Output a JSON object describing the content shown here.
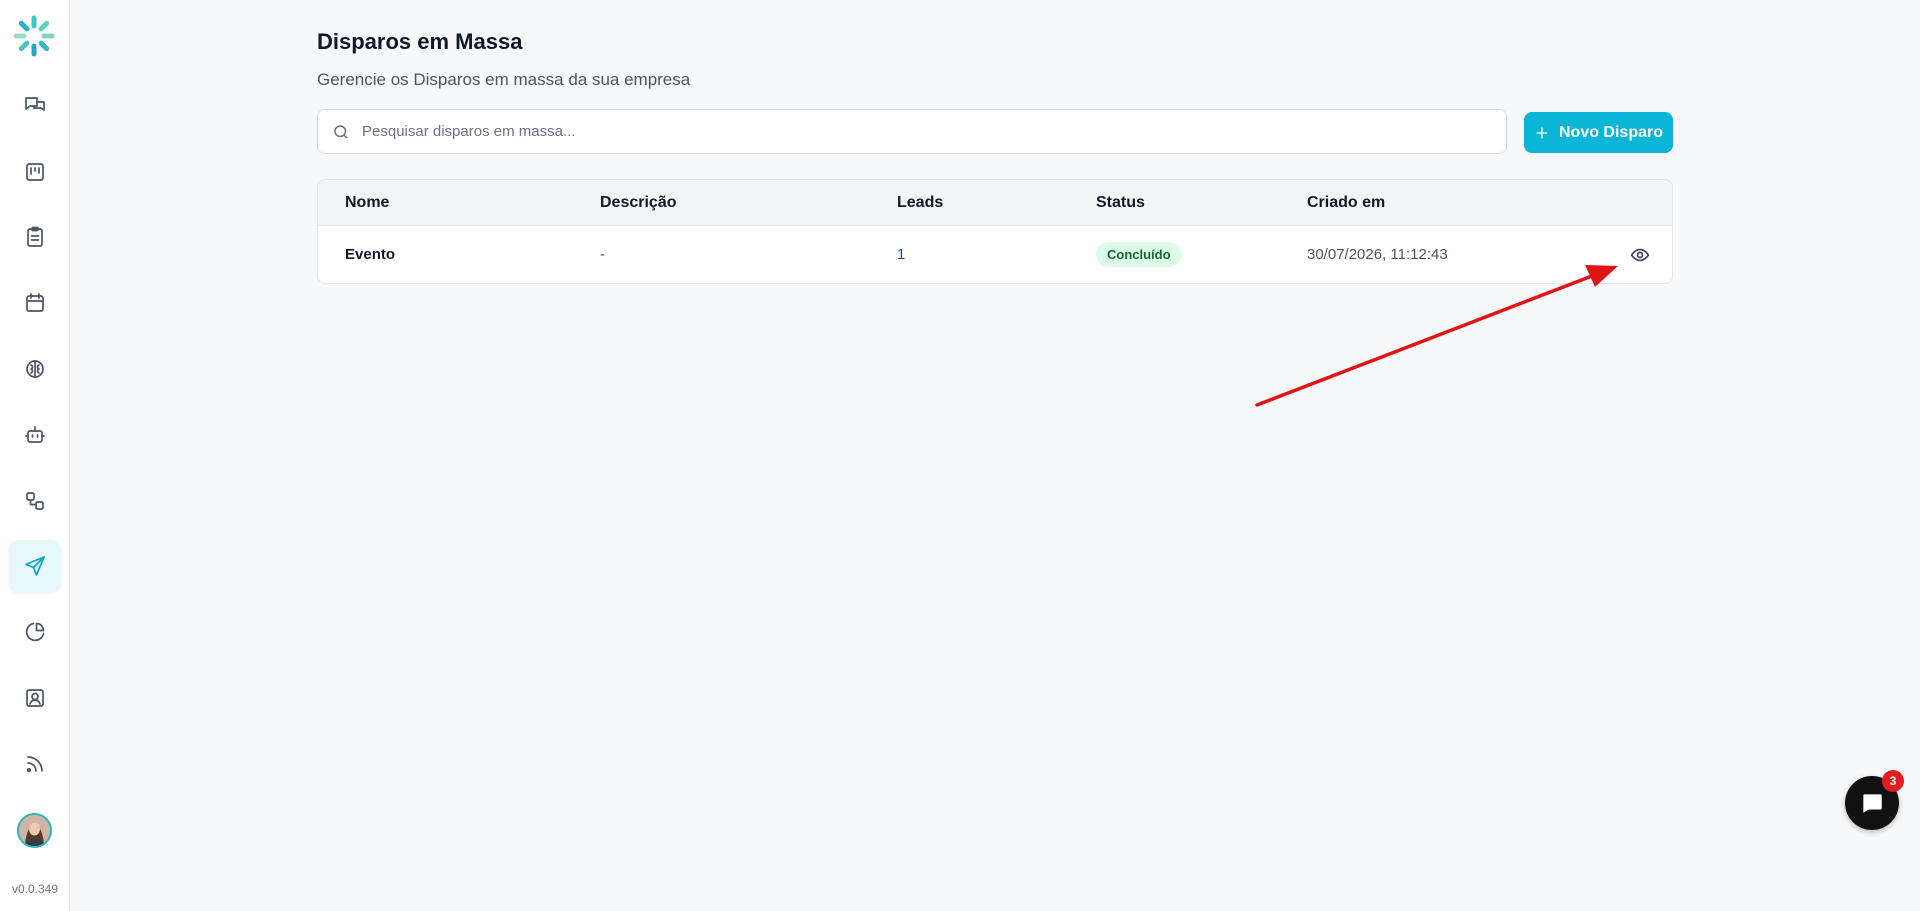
{
  "sidebar": {
    "items": [
      {
        "icon": "chat-icon"
      },
      {
        "icon": "kanban-icon"
      },
      {
        "icon": "clipboard-icon"
      },
      {
        "icon": "calendar-icon"
      },
      {
        "icon": "brain-icon"
      },
      {
        "icon": "bot-icon"
      },
      {
        "icon": "workflow-icon"
      },
      {
        "icon": "send-icon",
        "active": true
      },
      {
        "icon": "pie-chart-icon"
      },
      {
        "icon": "contact-icon"
      },
      {
        "icon": "rss-icon"
      }
    ],
    "version": "v0.0.349"
  },
  "header": {
    "title": "Disparos em Massa",
    "subtitle": "Gerencie os Disparos em massa da sua empresa"
  },
  "search": {
    "placeholder": "Pesquisar disparos em massa...",
    "value": ""
  },
  "actions": {
    "new_label": "Novo Disparo"
  },
  "table": {
    "columns": [
      "Nome",
      "Descrição",
      "Leads",
      "Status",
      "Criado em"
    ],
    "rows": [
      {
        "nome": "Evento",
        "descricao": "-",
        "leads": "1",
        "status": "Concluído",
        "criado_em": "30/07/2026, 11:12:43"
      }
    ]
  },
  "chat": {
    "badge_count": "3"
  },
  "colors": {
    "accent": "#0bb5d8",
    "status_success_bg": "#dcfce7",
    "status_success_text": "#166534",
    "annotation_arrow": "#e01515"
  }
}
